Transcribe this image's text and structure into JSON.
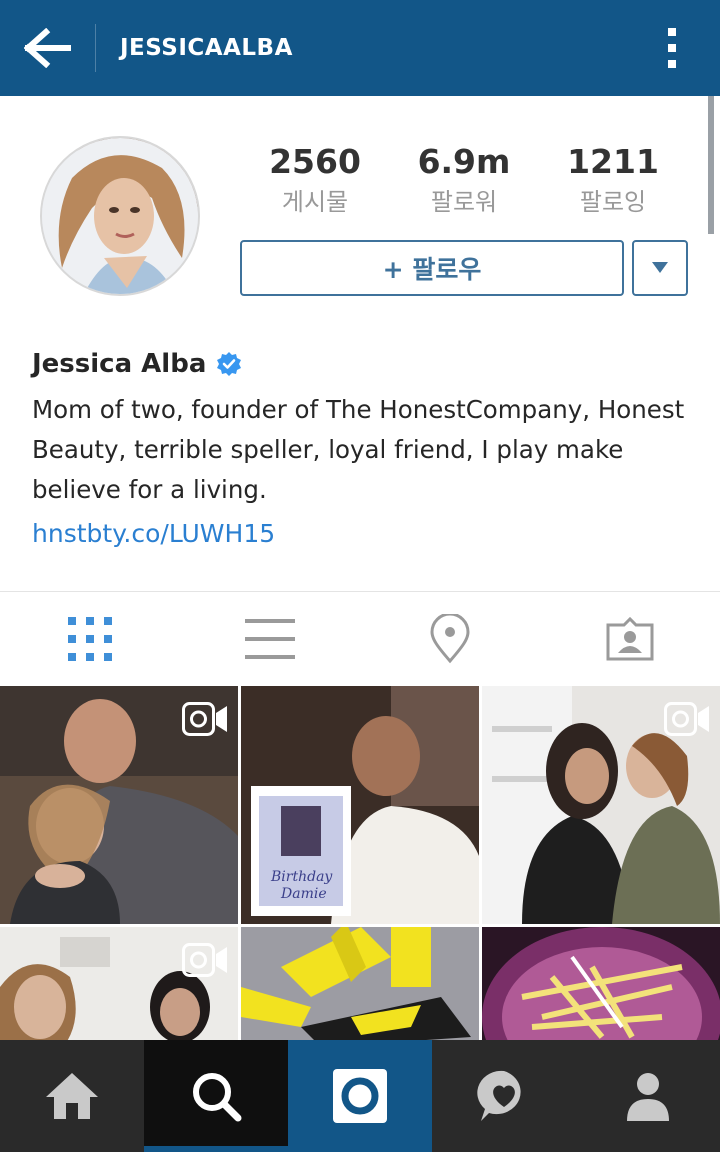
{
  "topbar": {
    "title": "JESSICAALBA",
    "back_icon": "arrow-left-icon",
    "menu_icon": "more-vertical-icon"
  },
  "profile": {
    "stats": [
      {
        "value": "2560",
        "label": "게시물"
      },
      {
        "value": "6.9m",
        "label": "팔로워"
      },
      {
        "value": "1211",
        "label": "팔로잉"
      }
    ],
    "follow_button": "+ 팔로우",
    "name": "Jessica Alba",
    "verified": true,
    "bio": "Mom of two, founder of The HonestCompany, Honest Beauty, terrible speller, loyal friend, I play make believe for a living.",
    "link": "hnstbty.co/LUWH15"
  },
  "tabs": [
    {
      "icon": "grid-icon",
      "active": true
    },
    {
      "icon": "list-icon",
      "active": false
    },
    {
      "icon": "location-pin-icon",
      "active": false
    },
    {
      "icon": "tagged-person-icon",
      "active": false
    }
  ],
  "bottom_nav": [
    {
      "icon": "home-icon",
      "active": false
    },
    {
      "icon": "search-icon",
      "active": true
    },
    {
      "icon": "camera-icon",
      "active": false
    },
    {
      "icon": "activity-heart-icon",
      "active": false
    },
    {
      "icon": "profile-icon",
      "active": false
    }
  ],
  "colors": {
    "brand": "#125688",
    "accent": "#3f729b",
    "link": "#2a7fd1",
    "verified": "#3897f0"
  }
}
